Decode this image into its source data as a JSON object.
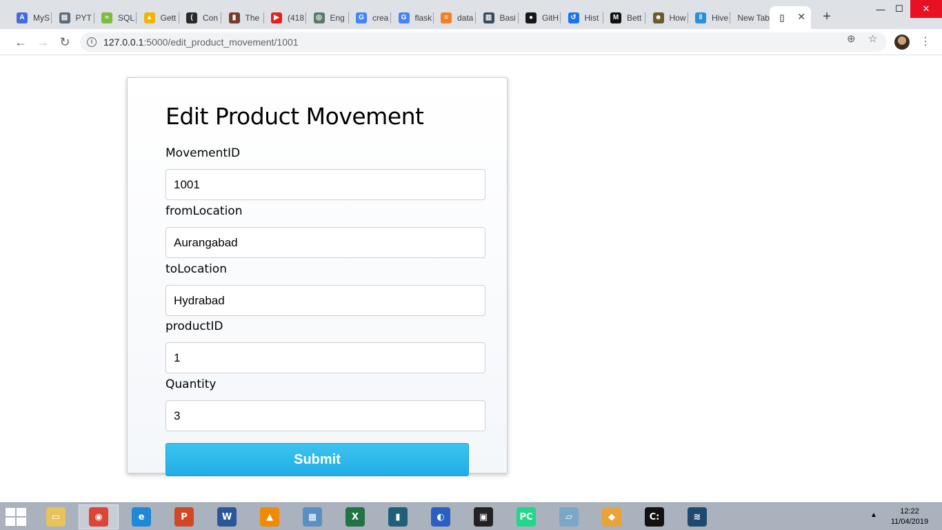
{
  "browser": {
    "tabs": [
      {
        "label": "MyS",
        "color": "#4a6bd6",
        "glyph": "A"
      },
      {
        "label": "PYT",
        "color": "#5a6b7a",
        "glyph": "▤"
      },
      {
        "label": "SQL",
        "color": "#7dbb3c",
        "glyph": "≈"
      },
      {
        "label": "Gett",
        "color": "#f2b400",
        "glyph": "▲"
      },
      {
        "label": "Con",
        "color": "#2a2a2a",
        "glyph": "("
      },
      {
        "label": "The",
        "color": "#7a3a2a",
        "glyph": "▮"
      },
      {
        "label": "(418",
        "color": "#e62117",
        "glyph": "▶"
      },
      {
        "label": "Eng",
        "color": "#5b7a6a",
        "glyph": "◎"
      },
      {
        "label": "crea",
        "color": "#4285f4",
        "glyph": "G"
      },
      {
        "label": "flask",
        "color": "#4285f4",
        "glyph": "G"
      },
      {
        "label": "data",
        "color": "#f48024",
        "glyph": "≡"
      },
      {
        "label": "Basi",
        "color": "#3a4a5a",
        "glyph": "▥"
      },
      {
        "label": "GitH",
        "color": "#181717",
        "glyph": "●"
      },
      {
        "label": "Hist",
        "color": "#1a73e8",
        "glyph": "↺"
      },
      {
        "label": "Bett",
        "color": "#111111",
        "glyph": "M"
      },
      {
        "label": "How",
        "color": "#6b5a2a",
        "glyph": "☻"
      },
      {
        "label": "Hive",
        "color": "#2a8fd6",
        "glyph": "‖"
      },
      {
        "label": "New Tab",
        "color": "",
        "glyph": ""
      },
      {
        "label": "",
        "color": "#ffffff",
        "glyph": "▯"
      }
    ],
    "url_host": "127.0.0.1",
    "url_path": ":5000/edit_product_movement/1001"
  },
  "form": {
    "title": "Edit Product Movement",
    "fields": [
      {
        "label": "MovementID",
        "value": "1001"
      },
      {
        "label": "fromLocation",
        "value": "Aurangabad"
      },
      {
        "label": "toLocation",
        "value": "Hydrabad"
      },
      {
        "label": "productID",
        "value": "1"
      },
      {
        "label": "Quantity",
        "value": "3"
      }
    ],
    "submit_label": "Submit"
  },
  "taskbar": {
    "apps": [
      {
        "name": "file-explorer",
        "color": "#e8c25a",
        "glyph": "▭"
      },
      {
        "name": "chrome",
        "color": "#db4437",
        "glyph": "◉"
      },
      {
        "name": "internet-explorer",
        "color": "#1e8ad6",
        "glyph": "e"
      },
      {
        "name": "powerpoint",
        "color": "#d24726",
        "glyph": "P"
      },
      {
        "name": "word",
        "color": "#2b579a",
        "glyph": "W"
      },
      {
        "name": "vlc",
        "color": "#f08a00",
        "glyph": "▲"
      },
      {
        "name": "network-app",
        "color": "#5a8fc4",
        "glyph": "▦"
      },
      {
        "name": "excel",
        "color": "#217346",
        "glyph": "X"
      },
      {
        "name": "terminal-app",
        "color": "#1f5f7a",
        "glyph": "▮"
      },
      {
        "name": "audacity",
        "color": "#2a5fc4",
        "glyph": "◐"
      },
      {
        "name": "mysql-console",
        "color": "#222222",
        "glyph": "▣"
      },
      {
        "name": "pycharm",
        "color": "#21d789",
        "glyph": "PC"
      },
      {
        "name": "notepad-app",
        "color": "#7aa7c7",
        "glyph": "▱"
      },
      {
        "name": "git-app",
        "color": "#e8a33a",
        "glyph": "◆"
      },
      {
        "name": "command-prompt",
        "color": "#111111",
        "glyph": "C:"
      },
      {
        "name": "mysql-workbench",
        "color": "#1f4a6f",
        "glyph": "≋"
      }
    ],
    "time": "12:22",
    "date": "11/04/2019"
  }
}
